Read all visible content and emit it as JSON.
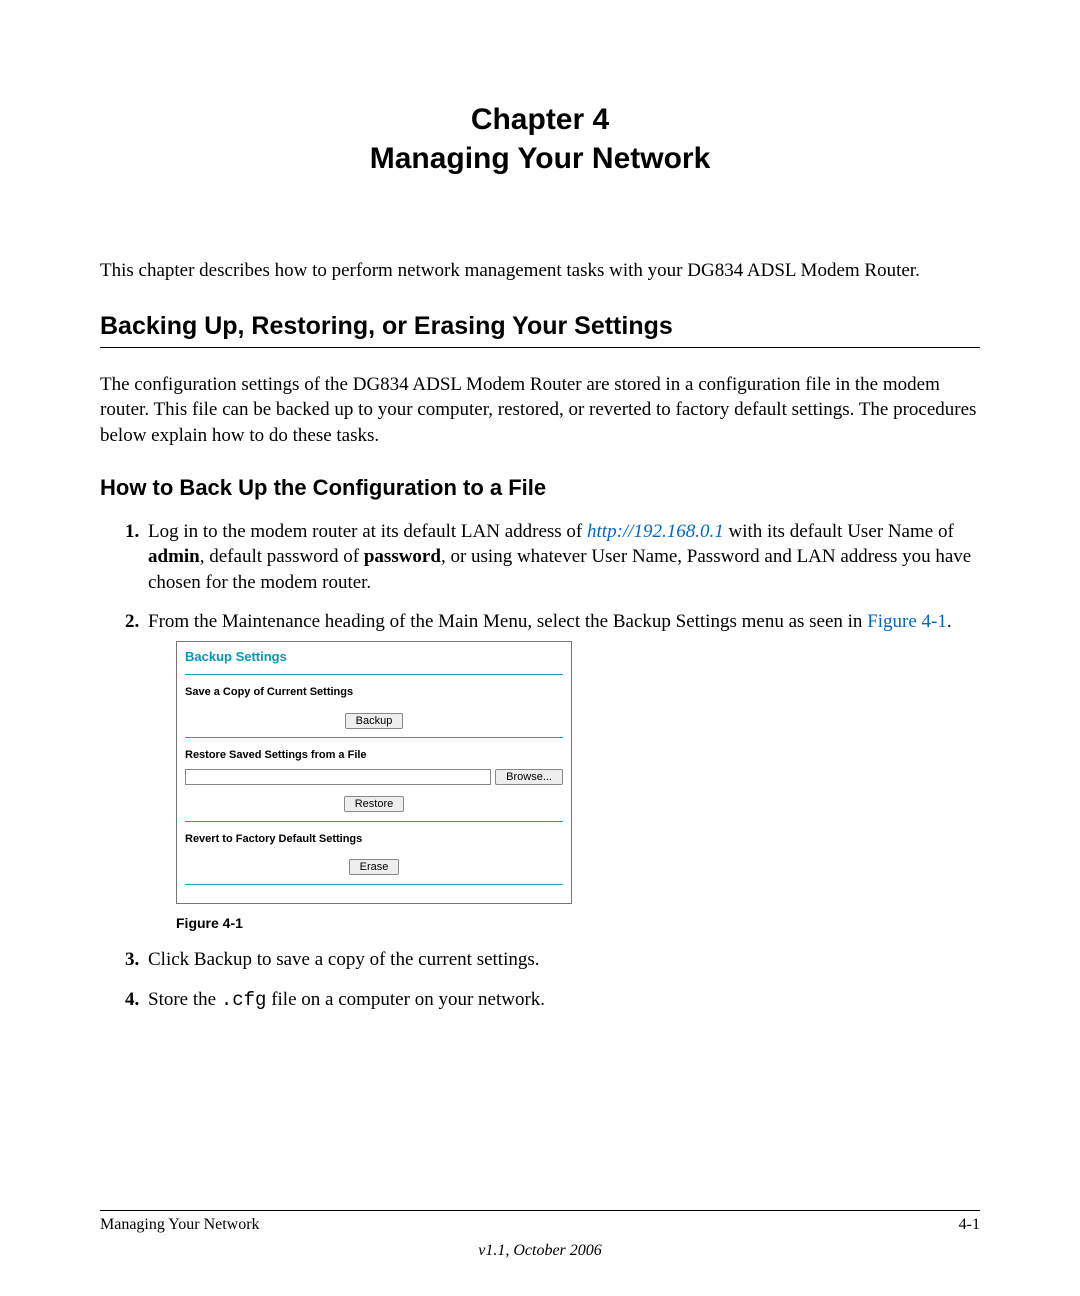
{
  "chapter": {
    "line1": "Chapter 4",
    "line2": "Managing Your Network"
  },
  "intro": "This chapter describes how to perform network management tasks with your DG834 ADSL Modem Router.",
  "section": {
    "title": "Backing Up, Restoring, or Erasing Your Settings",
    "body": "The configuration settings of the DG834 ADSL Modem Router are stored in a configuration file in the modem router. This file can be backed up to your computer, restored, or reverted to factory default settings. The procedures below explain how to do these tasks."
  },
  "subsection": {
    "title": "How to Back Up the Configuration to a File"
  },
  "steps": {
    "s1_a": "Log in to the modem router at its default LAN address of ",
    "s1_link": "http://192.168.0.1",
    "s1_b": " with its default User Name of ",
    "s1_admin": "admin",
    "s1_c": ", default password of ",
    "s1_password": "password",
    "s1_d": ", or using whatever User Name, Password and LAN address you have chosen for the modem router.",
    "s2_a": "From the Maintenance heading of the Main Menu, select the Backup Settings menu as seen in ",
    "s2_figref": "Figure 4-1",
    "s2_b": ".",
    "s3": "Click Backup to save a copy of the current settings.",
    "s4_a": "Store the ",
    "s4_code": ".cfg",
    "s4_b": " file on a computer on your network."
  },
  "figure": {
    "heading": "Backup Settings",
    "save_label": "Save a Copy of Current Settings",
    "backup_btn": "Backup",
    "restore_label": "Restore Saved Settings from a File",
    "browse_btn": "Browse...",
    "restore_btn": "Restore",
    "revert_label": "Revert to Factory Default Settings",
    "erase_btn": "Erase",
    "caption": "Figure 4-1"
  },
  "footer": {
    "left": "Managing Your Network",
    "right": "4-1",
    "version": "v1.1, October 2006"
  }
}
